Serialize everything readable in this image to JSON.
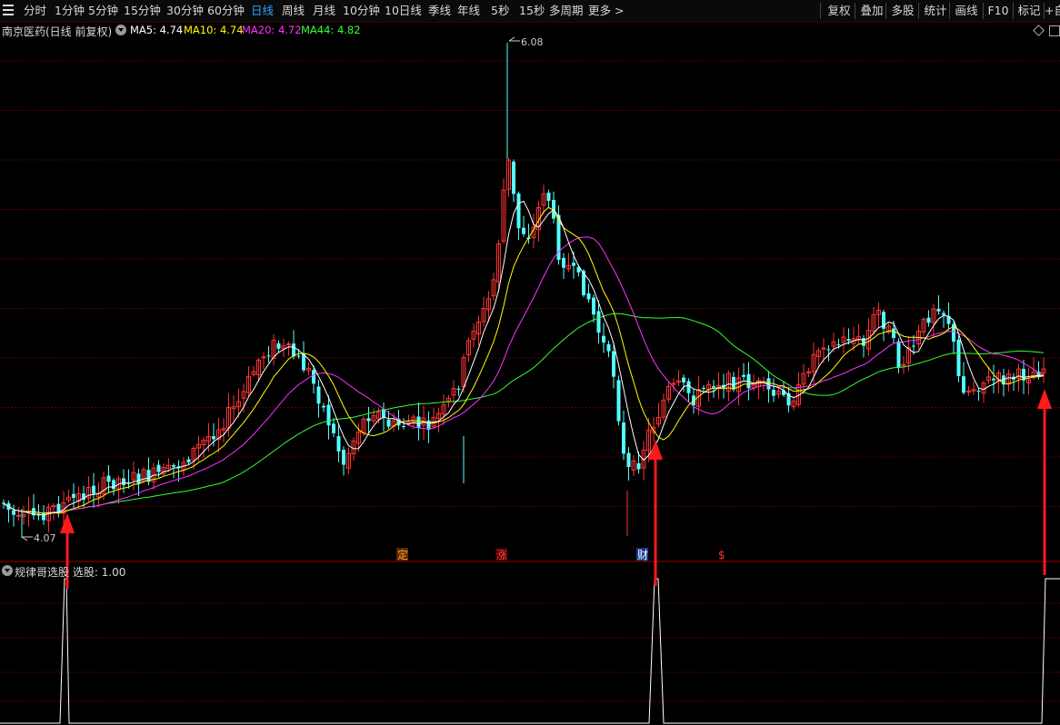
{
  "toolbar": {
    "periods": [
      "分时",
      "1分钟",
      "5分钟",
      "15分钟",
      "30分钟",
      "60分钟",
      "日线",
      "周线",
      "月线",
      "10分钟",
      "10日线",
      "季线",
      "年线",
      "5秒",
      "15秒",
      "多周期",
      "更多 >"
    ],
    "active_index": 6,
    "right_buttons": [
      "复权",
      "叠加",
      "多股",
      "统计",
      "画线",
      "F10",
      "标记",
      "+自"
    ]
  },
  "stock": {
    "title": "南京医药(日线 前复权)"
  },
  "ma": [
    {
      "label": "MA5: 4.74",
      "color": "#ffffff"
    },
    {
      "label": "MA10: 4.74",
      "color": "#ffff00"
    },
    {
      "label": "MA20: 4.72",
      "color": "#ff33ff"
    },
    {
      "label": "MA44: 4.82",
      "color": "#33ff33"
    }
  ],
  "price": {
    "high_label": "6.08",
    "low_label": "4.07"
  },
  "markers": [
    {
      "text": "定",
      "color": "#ff9944",
      "bg": "#5a2a00"
    },
    {
      "text": "涨",
      "color": "#ff4444",
      "bg": "#4a0000"
    },
    {
      "text": "财",
      "color": "#ffffff",
      "bg": "#1a3a8a"
    },
    {
      "text": "$",
      "color": "#ff3333",
      "bg": "transparent"
    }
  ],
  "indicator": {
    "title": "规律哥选股 选股: 1.00"
  },
  "colors": {
    "up": "#ff3232",
    "down": "#54ffff",
    "ma5": "#ffffff",
    "ma10": "#ffff00",
    "ma20": "#ff33ff",
    "ma44": "#33ff33",
    "grid": "#5a0000",
    "arrow": "#ff1a1a"
  },
  "chart_data": {
    "type": "candlestick",
    "subtype": "daily K-line with moving averages and signal indicator",
    "price_extremes": {
      "high": 6.08,
      "low": 4.07
    },
    "moving_averages": {
      "MA5": 4.74,
      "MA10": 4.74,
      "MA20": 4.72,
      "MA44": 4.82
    },
    "signal": {
      "name": "选股",
      "value": 1.0,
      "signal_count": 3
    }
  }
}
